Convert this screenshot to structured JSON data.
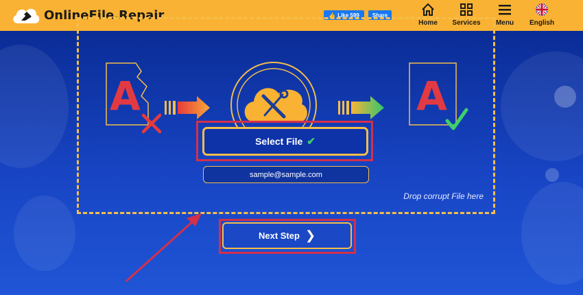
{
  "header": {
    "brand": "OnlineFile.Repair",
    "fb_like": "Like 599",
    "fb_share": "Share",
    "nav": [
      {
        "label": "Home",
        "icon": "home-icon"
      },
      {
        "label": "Services",
        "icon": "grid-icon"
      },
      {
        "label": "Menu",
        "icon": "hamburger-icon"
      },
      {
        "label": "English",
        "icon": "uk-flag-icon"
      }
    ]
  },
  "upload": {
    "select_label": "Select File",
    "email_value": "sample@sample.com",
    "drop_hint": "Drop corrupt File here",
    "next_label": "Next Step"
  },
  "colors": {
    "header_bg": "#f9b233",
    "accent_yellow": "#f5be4b",
    "highlight_red": "#d4304a",
    "bg_blue": "#1a43b8",
    "check_green": "#3fd06b"
  }
}
